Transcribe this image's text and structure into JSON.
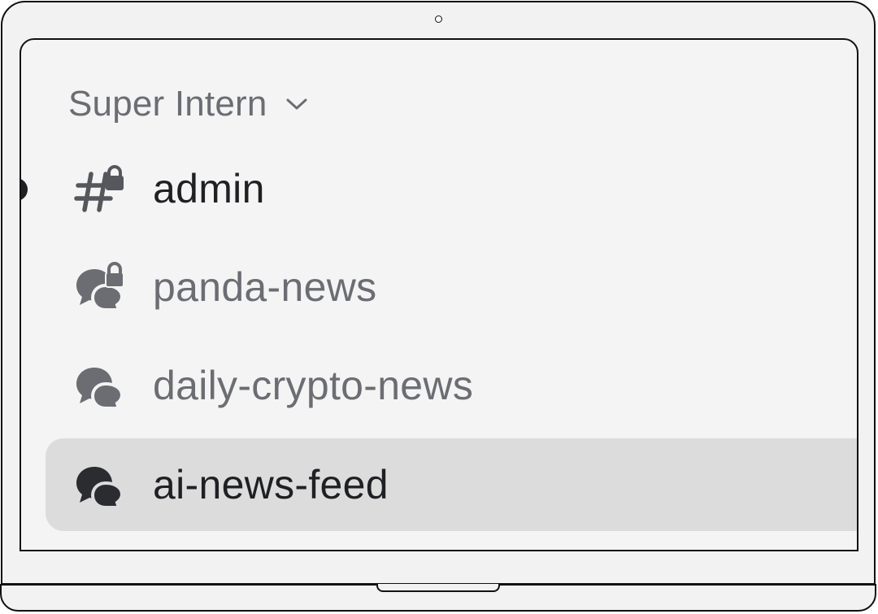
{
  "server": {
    "name": "Super Intern",
    "dropdown_icon": "chevron-down-icon"
  },
  "channels": [
    {
      "label": "admin",
      "icon": "locked-text-channel-icon",
      "unread": true,
      "selected": false
    },
    {
      "label": "panda-news",
      "icon": "locked-forum-channel-icon",
      "unread": false,
      "selected": false
    },
    {
      "label": "daily-crypto-news",
      "icon": "forum-channel-icon",
      "unread": false,
      "selected": false
    },
    {
      "label": "ai-news-feed",
      "icon": "forum-channel-icon",
      "unread": false,
      "selected": true
    }
  ],
  "colors": {
    "muted_text": "#6b6d73",
    "active_text": "#1f2024",
    "selected_bg": "#dcdcdd",
    "screen_bg": "#f4f4f4"
  }
}
